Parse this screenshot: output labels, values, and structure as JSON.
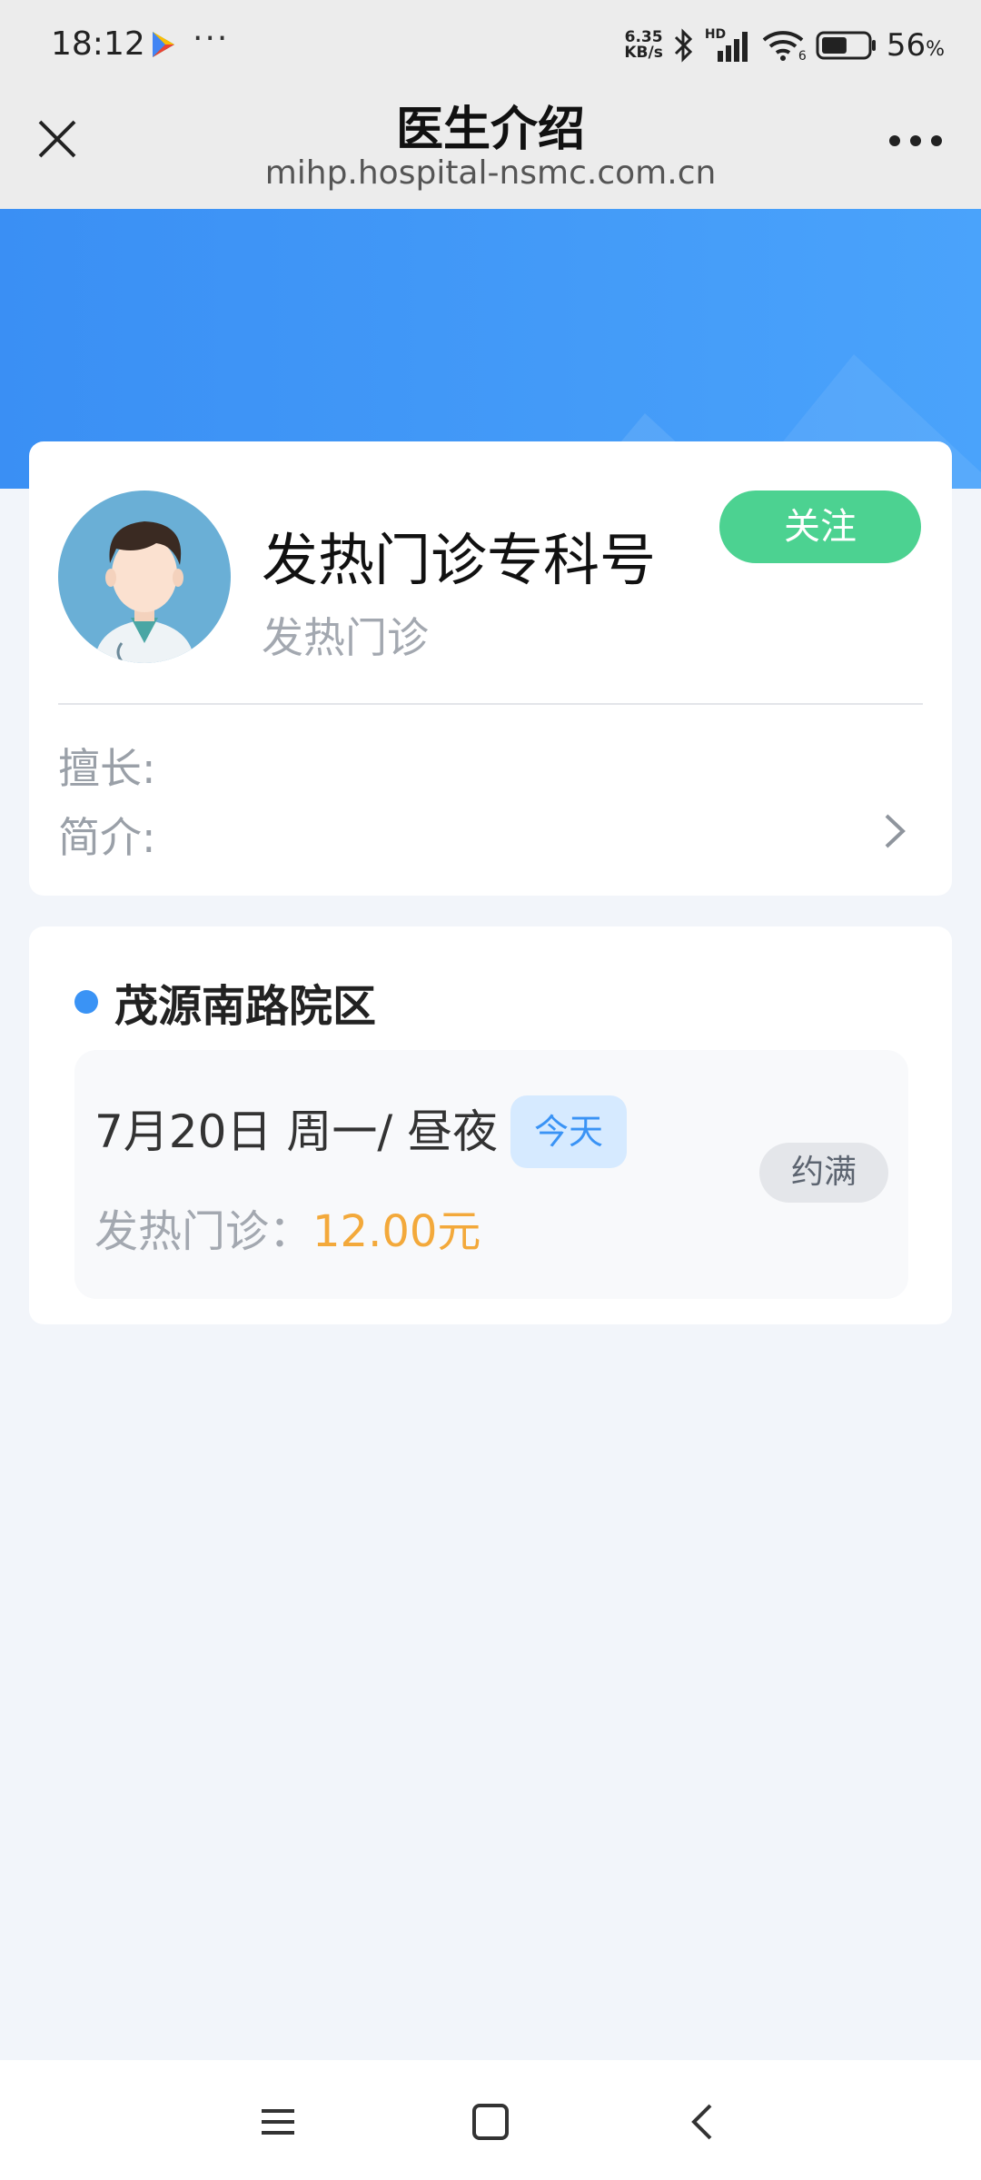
{
  "status_bar": {
    "time": "18:12",
    "more": "···",
    "net_speed_value": "6.35",
    "net_speed_unit": "KB/s",
    "hd": "HD",
    "wifi_num": "6",
    "battery_value": "56",
    "battery_unit": "%",
    "battery_level": 56
  },
  "nav": {
    "title": "医生介绍",
    "url": "mihp.hospital-nsmc.com.cn"
  },
  "doctor": {
    "name": "发热门诊专科号",
    "department": "发热门诊",
    "follow_label": "关注",
    "specialty_label": "擅长:",
    "intro_label": "简介:"
  },
  "branch": {
    "name": "茂源南路院区",
    "slot": {
      "date": "7月20日 周一/ 昼夜",
      "today_label": "今天",
      "dept_label": "发热门诊：",
      "price": "12.00元",
      "status_label": "约满"
    }
  },
  "colors": {
    "hero_start": "#3a8ff4",
    "hero_end": "#4aa3fb",
    "follow": "#4cd291",
    "price": "#f3a93b",
    "accent": "#3a93f5"
  }
}
